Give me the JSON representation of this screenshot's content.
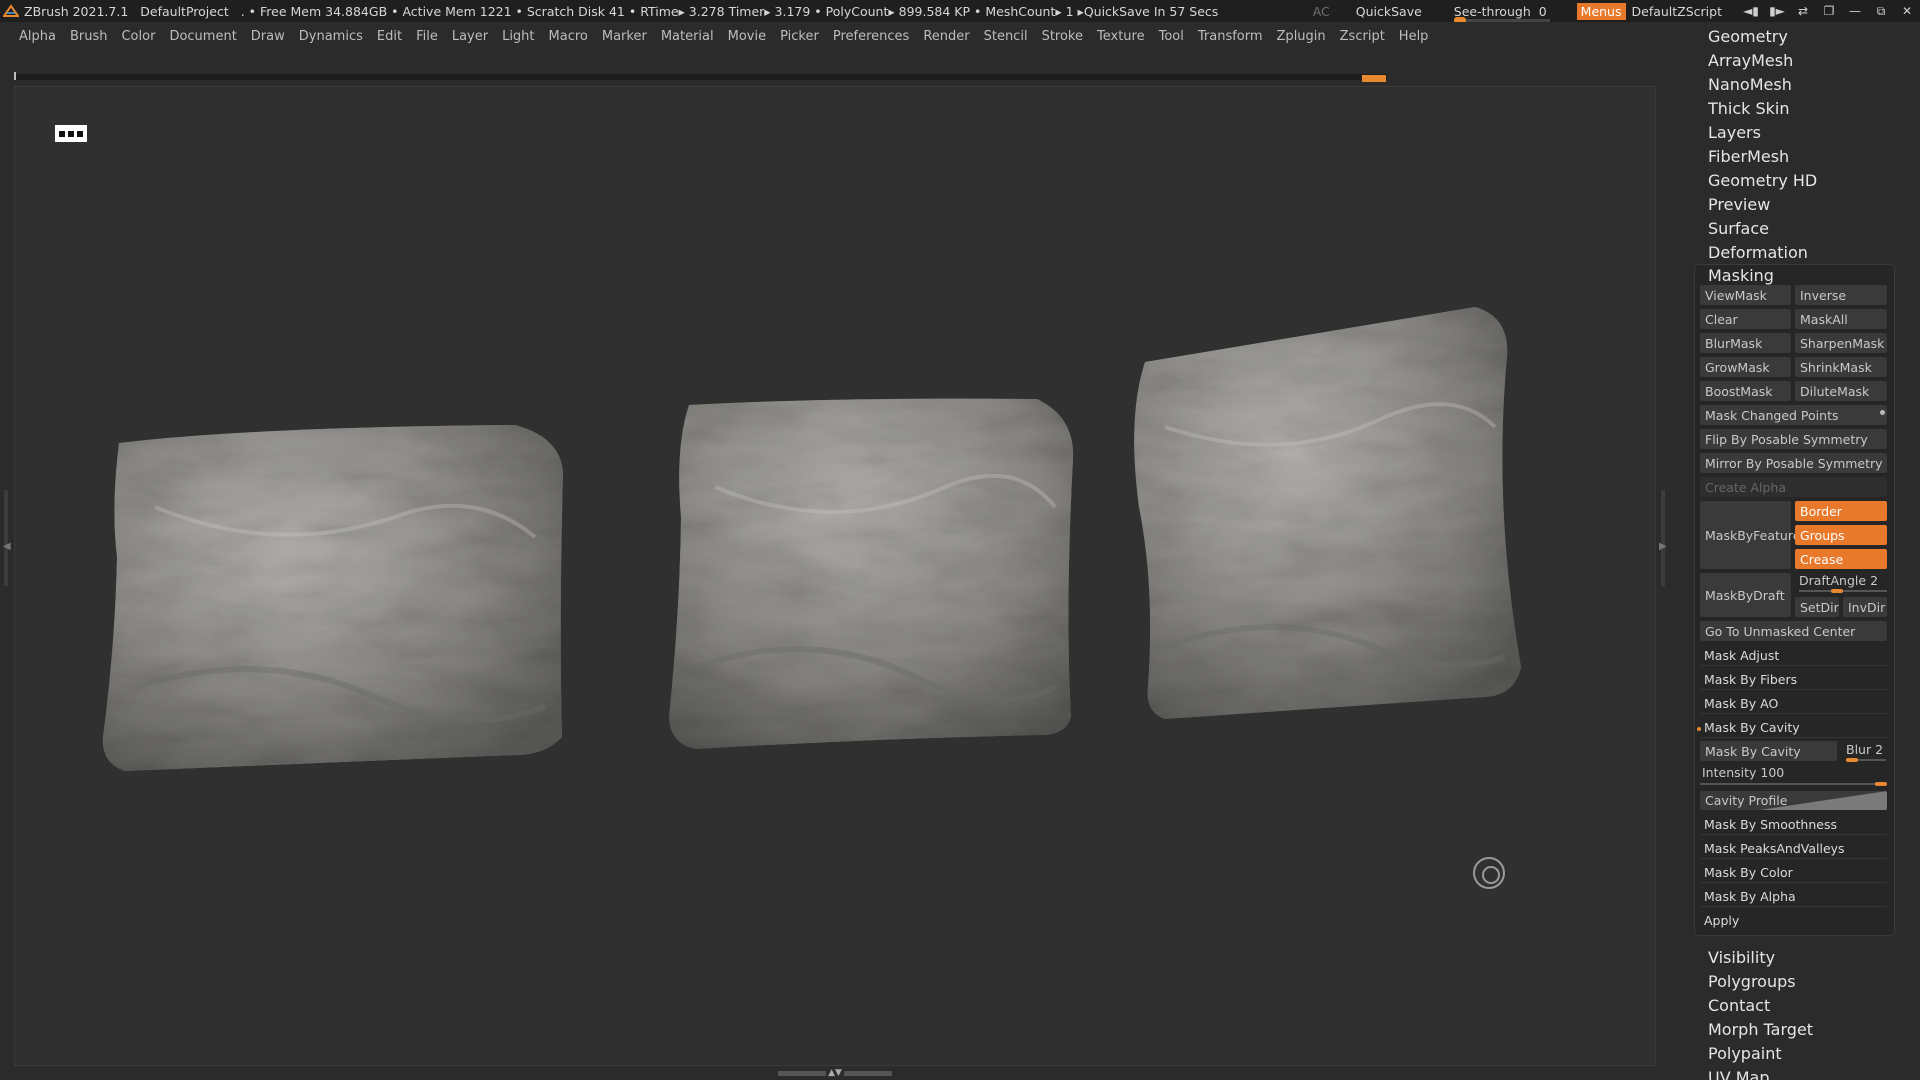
{
  "titlebar": {
    "app_version": "ZBrush 2021.7.1",
    "project": "DefaultProject",
    "status": ". • Free Mem 34.884GB • Active Mem 1221 • Scratch Disk 41 •  RTime▸ 3.278 Timer▸ 3.179 • PolyCount▸ 899.584 KP  • MeshCount▸ 1  ▸QuickSave In 57 Secs",
    "ac": "AC",
    "quicksave": "QuickSave",
    "see_through_label": "See-through",
    "see_through_value": "0",
    "menus": "Menus",
    "default_zscript": "DefaultZScript",
    "accent_color": "#e8782a"
  },
  "menubar": [
    "Alpha",
    "Brush",
    "Color",
    "Document",
    "Draw",
    "Dynamics",
    "Edit",
    "File",
    "Layer",
    "Light",
    "Macro",
    "Marker",
    "Material",
    "Movie",
    "Picker",
    "Preferences",
    "Render",
    "Stencil",
    "Stroke",
    "Texture",
    "Tool",
    "Transform",
    "Zplugin",
    "Zscript",
    "Help"
  ],
  "tool_subpalettes_top": [
    "Geometry",
    "ArrayMesh",
    "NanoMesh",
    "Thick Skin",
    "Layers",
    "FiberMesh",
    "Geometry HD",
    "Preview",
    "Surface",
    "Deformation"
  ],
  "masking": {
    "title": "Masking",
    "viewmask": "ViewMask",
    "inverse": "Inverse",
    "clear": "Clear",
    "maskall": "MaskAll",
    "blurmask": "BlurMask",
    "sharpenmask": "SharpenMask",
    "growmask": "GrowMask",
    "shrinkmask": "ShrinkMask",
    "boostmask": "BoostMask",
    "dilutemask": "DiluteMask",
    "mask_changed_points": "Mask Changed Points",
    "flip_by_posable_symmetry": "Flip By Posable Symmetry",
    "mirror_by_posable_symmetry": "Mirror By Posable Symmetry",
    "create_alpha": "Create Alpha",
    "maskbyfeature": "MaskByFeature",
    "border": "Border",
    "groups": "Groups",
    "crease": "Crease",
    "maskbydraft": "MaskByDraft",
    "draftangle_label": "DraftAngle",
    "draftangle_value": "2",
    "setdir": "SetDir",
    "invdir": "InvDir",
    "go_to_unmasked_center": "Go To Unmasked Center",
    "mask_adjust": "Mask Adjust",
    "mask_by_fibers": "Mask By Fibers",
    "mask_by_ao": "Mask By AO",
    "mask_by_cavity_section": "Mask By Cavity",
    "mask_by_cavity_button": "Mask By Cavity",
    "blur_label": "Blur",
    "blur_value": "2",
    "intensity_label": "Intensity",
    "intensity_value": "100",
    "cavity_profile": "Cavity Profile",
    "mask_by_smoothness": "Mask By Smoothness",
    "mask_peaks_and_valleys": "Mask PeaksAndValleys",
    "mask_by_color": "Mask By Color",
    "mask_by_alpha": "Mask By Alpha",
    "apply": "Apply"
  },
  "tool_subpalettes_bottom": [
    "Visibility",
    "Polygroups",
    "Contact",
    "Morph Target",
    "Polypaint",
    "UV Map"
  ],
  "icons": [
    "zbrush-logo-icon",
    "perspective-toggle-icon",
    "navigation-target-icon",
    "window-restore-icon",
    "minimize-icon",
    "maximize-icon",
    "close-icon"
  ]
}
